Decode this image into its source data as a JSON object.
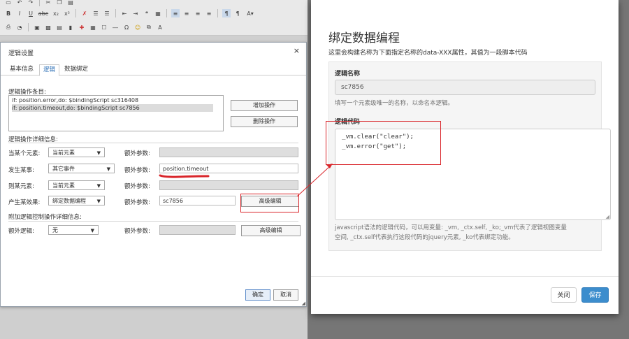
{
  "toolbar": {
    "row1": [
      "save-icon",
      "undo-icon",
      "redo-icon",
      "cut-icon",
      "copy-icon",
      "paste-icon"
    ],
    "row2": [
      "B",
      "I",
      "U",
      "abc",
      "x₂",
      "x²"
    ],
    "row3": [
      "print-icon",
      "preview-icon",
      "template-icon",
      "image-icon",
      "chart-icon",
      "flag-icon",
      "special-icon"
    ]
  },
  "logic_dialog": {
    "title": "逻辑设置",
    "close": "×",
    "tabs": [
      "基本信息",
      "逻辑",
      "数据绑定"
    ],
    "ops_label": "逻辑操作条目:",
    "ops": [
      "if: position.error,do: $bindingScript sc316408",
      "if: position.timeout,do: $bindingScript sc7856"
    ],
    "add_button": "增加操作",
    "delete_button": "删除操作",
    "detail_label": "逻辑操作详细信息:",
    "rows": [
      {
        "label": "当某个元素:",
        "select": "当前元素",
        "param_label": "额外参数:",
        "param": ""
      },
      {
        "label": "发生某事:",
        "select": "其它事件",
        "param_label": "额外参数:",
        "param": "position.timeout"
      },
      {
        "label": "则某元素:",
        "select": "当前元素",
        "param_label": "额外参数:",
        "param": ""
      },
      {
        "label": "产生某效果:",
        "select": "绑定数据编程",
        "param_label": "额外参数:",
        "param": "sc7856"
      }
    ],
    "advanced_edit": "高级编辑",
    "extra_label": "附加逻辑控制操作详细信息:",
    "extra_logic_label": "额外逻辑:",
    "extra_logic_select": "无",
    "extra_param_label": "额外参数:",
    "advanced_edit_2": "高级编辑",
    "ok": "确定",
    "cancel": "取消"
  },
  "bind_modal": {
    "title": "绑定数据编程",
    "subtitle": "这里会构建名称为下面指定名称的data-XXX属性，其值为一段脚本代码",
    "name_label": "逻辑名称",
    "name_value": "sc7856",
    "name_help": "填写一个元素级唯一的名称，以命名本逻辑。",
    "code_label": "逻辑代码",
    "code_lines": [
      "_vm.clear(\"clear\");",
      "_vm.error(\"get\");"
    ],
    "code_help_1": "javascript语法的逻辑代码，可以用变量: _vm, _ctx.self, _ko;_vm代表了逻辑视图变量",
    "code_help_2": "空间, _ctx.self代表执行这段代码的jquery元素, _ko代表绑定功能。",
    "close_button": "关闭",
    "save_button": "保存"
  },
  "colors": {
    "annotation": "#d9252a",
    "primary": "#3c8dcd",
    "link_tab": "#2a6db5"
  }
}
